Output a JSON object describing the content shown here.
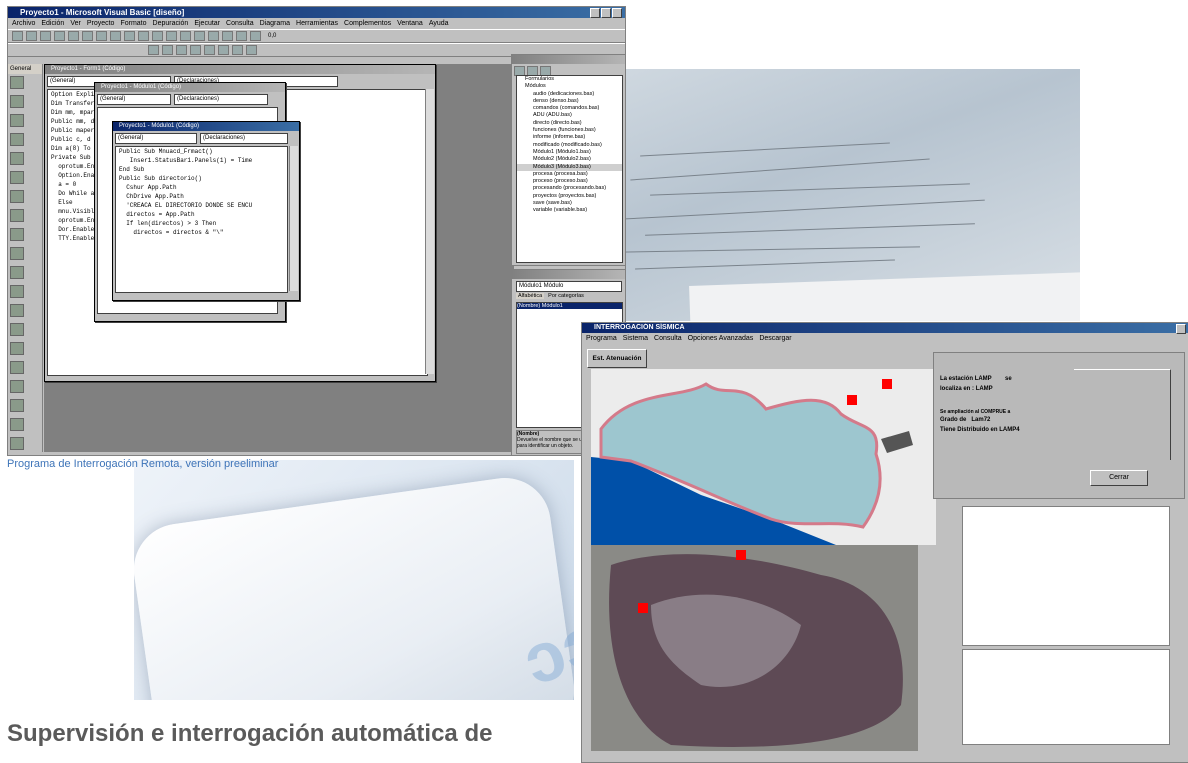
{
  "vb_ide": {
    "title": "Proyecto1 - Microsoft Visual Basic [diseño]",
    "menu": [
      "Archivo",
      "Edición",
      "Ver",
      "Proyecto",
      "Formato",
      "Depuración",
      "Ejecutar",
      "Consulta",
      "Diagrama",
      "Herramientas",
      "Complementos",
      "Ventana",
      "Ayuda"
    ],
    "position_readout": "0,0",
    "code_windows": [
      {
        "title": "Proyecto1 - Form1 (Código)",
        "object": "(General)",
        "proc": "(Declaraciones)"
      },
      {
        "title": "Proyecto1 - Módulo1 (Código)",
        "object": "(General)",
        "proc": "(Declaraciones)"
      },
      {
        "title": "Proyecto1 - Módulo1 (Código)",
        "object": "(General)",
        "proc": "(Declaraciones)"
      }
    ],
    "code_lines": [
      "Public Sub Mnuacd_Frmact()",
      "",
      "   Inser1.StatusBar1.Panels(1) = Time",
      "End Sub",
      "",
      "Public Sub directorio()",
      "  Cshur App.Path",
      "  ChDrive App.Path",
      "  'CREACA EL DIRECTORIO DONDE SE ENCU",
      "  directos = App.Path",
      "  If len(directos) > 3 Then",
      "    directos = directos & \"\\\""
    ],
    "back_code_lines": [
      "Option Explicit",
      "Dim TransferFile",
      "Dim mm, mparam",
      "Public mm, d",
      "Public mapera",
      "Public c, d",
      "Dim a(8) To 8",
      "Private Sub Form",
      "  oprotum.Enab",
      "  Option.Enab",
      "  a = 0",
      "  Do While a <= 8",
      "",
      "  Else",
      "  mnu.Visible = False",
      "  oprotum.Enabled = True",
      "  Dor.Enabled = True",
      "  TTY.Enabled = True"
    ],
    "project_tree": [
      "Formularios",
      "Módulos",
      "audio (dedicaciones.bas)",
      "denso (denso.bas)",
      "comandos (comandos.bas)",
      "ADU (ADU.bas)",
      "directo (directo.bas)",
      "funciones (funciones.bas)",
      "informe (informe.bas)",
      "modificado (modificado.bas)",
      "Módulo1 (Módulo1.bas)",
      "Módulo2 (Módulo2.bas)",
      "Módulo3 (Módulo3.bas)",
      "procesa (procesa.bas)",
      "proceso (proceso.bas)",
      "procesando (procesando.bas)",
      "proyectos (proyectos.bas)",
      "save (save.bas)",
      "variable (variable.bas)"
    ],
    "props_title": "Módulo1 Módulo",
    "props_tabs": [
      "Alfabética",
      "Por categorías"
    ],
    "props_row": "(Nombre) Módulo1",
    "props_desc_title": "(Nombre)",
    "props_desc": "Devuelve el nombre que se utiliza en el código para identificar un objeto."
  },
  "caption": "Programa de Interrogación Remota, versión preeliminar",
  "headline": "Supervisión e interrogación automática de",
  "seismic_app": {
    "title": "INTERROGACIÓN SÍSMICA",
    "menu": [
      "Programa",
      "Sistema",
      "Consulta",
      "Opciones Avanzadas",
      "Descargar"
    ],
    "button_station": "Est. Atenuación",
    "info": {
      "line1_label": "La estación",
      "line1_value": "LAMP",
      "line1_extra": "se",
      "line2_label": "localiza en :",
      "line2_value": "LAMP",
      "line3": "Se ampliación al COMPRUE a",
      "line4_label": "Grado de",
      "line4_value": "Lam72",
      "line5_label": "Tiene Distribuido en",
      "line5_value": "LAMP4"
    },
    "button_close": "Cerrar",
    "colors": {
      "marker": "#ff0000",
      "sea": "#0050a8",
      "land_top": "#9dc6cf",
      "land_bottom": "#5e4a55"
    }
  }
}
